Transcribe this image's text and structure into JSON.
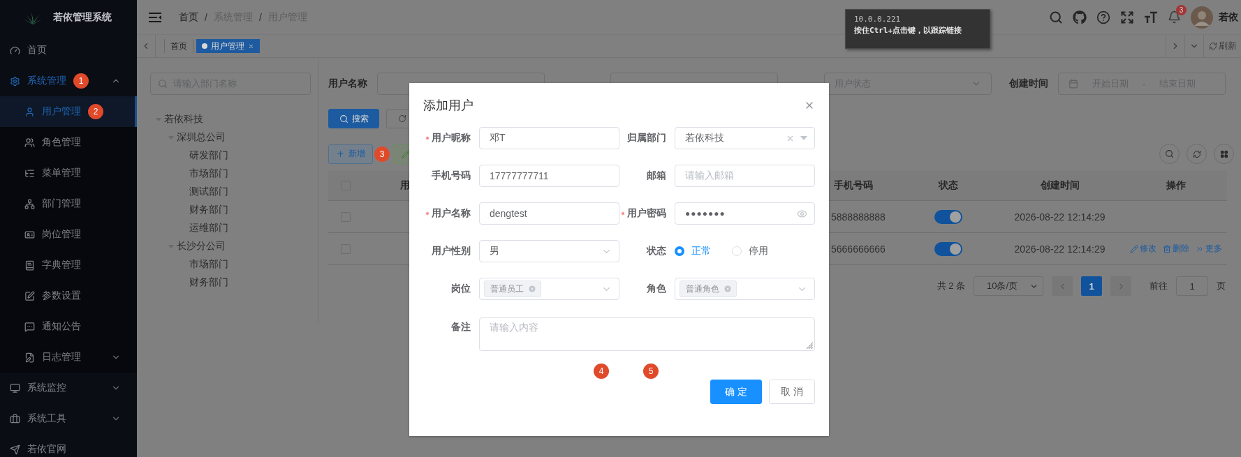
{
  "app": {
    "title": "若依管理系统"
  },
  "sidebar": {
    "items": [
      {
        "label": "首页",
        "selected": false
      },
      {
        "label": "系统管理",
        "selected": false,
        "expanded": true,
        "step": "1",
        "children": [
          {
            "label": "用户管理",
            "selected": true,
            "step": "2"
          },
          {
            "label": "角色管理",
            "selected": false
          },
          {
            "label": "菜单管理",
            "selected": false
          },
          {
            "label": "部门管理",
            "selected": false
          },
          {
            "label": "岗位管理",
            "selected": false
          },
          {
            "label": "字典管理",
            "selected": false
          },
          {
            "label": "参数设置",
            "selected": false
          },
          {
            "label": "通知公告",
            "selected": false
          },
          {
            "label": "日志管理",
            "selected": false,
            "expanded": false
          }
        ]
      },
      {
        "label": "系统监控",
        "selected": false,
        "expanded": false
      },
      {
        "label": "系统工具",
        "selected": false,
        "expanded": false
      },
      {
        "label": "若依官网",
        "selected": false
      }
    ]
  },
  "header": {
    "breadcrumb": [
      "首页",
      "系统管理",
      "用户管理"
    ],
    "separator": "/",
    "notifications": "3",
    "user": "若依"
  },
  "tooltip": {
    "lines": [
      "10.0.0.221",
      "按住Ctrl+点击键，以跟踪链接"
    ]
  },
  "tags": [
    {
      "label": "首页",
      "selected": false
    },
    {
      "label": "用户管理",
      "selected": true
    }
  ],
  "refresh": "刷新",
  "dept_panel": {
    "placeholder": "请输入部门名称",
    "tree": [
      {
        "label": "若依科技",
        "expanded": true,
        "children": [
          {
            "label": "深圳总公司",
            "expanded": true,
            "children": [
              {
                "label": "研发部门"
              },
              {
                "label": "市场部门"
              },
              {
                "label": "测试部门"
              },
              {
                "label": "财务部门"
              },
              {
                "label": "运维部门"
              }
            ]
          },
          {
            "label": "长沙分公司",
            "expanded": true,
            "children": [
              {
                "label": "市场部门"
              },
              {
                "label": "财务部门"
              }
            ]
          }
        ]
      }
    ]
  },
  "filters": [
    {
      "kind": "input",
      "label": "用户名称"
    },
    {
      "kind": "input"
    },
    {
      "kind": "select",
      "placeholder": "用户状态"
    },
    {
      "kind": "daterange",
      "label": "创建时间",
      "start": "开始日期",
      "separator": "-",
      "end": "结束日期"
    }
  ],
  "search_button": "搜索",
  "add_button": {
    "label": "新增",
    "step": "3"
  },
  "table": {
    "header_checked": false,
    "columns": [
      "用",
      "手机号码",
      "状态",
      "创建时间",
      "操作"
    ],
    "rows": [
      {
        "checked": false,
        "phone": "5888888888",
        "on": true,
        "created": "2026-08-22 12:14:29",
        "actions": []
      },
      {
        "checked": false,
        "phone": "5666666666",
        "on": true,
        "created": "2026-08-22 12:14:29",
        "actions": [
          "修改",
          "删除",
          "更多"
        ]
      }
    ]
  },
  "pagination": {
    "total": "共 2 条",
    "page_size": "10条/页",
    "pages": [
      {
        "label": "1",
        "selected": true
      }
    ],
    "goto": "前往",
    "goto_value": "1",
    "page_unit": "页"
  },
  "dialog": {
    "title": "添加用户",
    "fields": [
      {
        "kind": "input",
        "label": "用户昵称",
        "required": true,
        "value": "邓T"
      },
      {
        "kind": "tree-select",
        "label": "归属部门",
        "required": false,
        "value": "若依科技"
      },
      {
        "kind": "input",
        "label": "手机号码",
        "required": false,
        "value": "17777777711"
      },
      {
        "kind": "input",
        "label": "邮箱",
        "required": false,
        "placeholder": "请输入邮箱"
      },
      {
        "kind": "input",
        "label": "用户名称",
        "required": true,
        "value": "dengtest"
      },
      {
        "kind": "password",
        "label": "用户密码",
        "required": true,
        "value": "●●●●●●●"
      },
      {
        "kind": "select",
        "label": "用户性别",
        "required": false,
        "value": "男"
      },
      {
        "kind": "radio",
        "label": "状态",
        "required": false,
        "options": [
          {
            "label": "正常",
            "selected": true
          },
          {
            "label": "停用",
            "selected": false
          }
        ]
      },
      {
        "kind": "multi-select",
        "label": "岗位",
        "required": false,
        "tags": [
          "普通员工"
        ]
      },
      {
        "kind": "multi-select",
        "label": "角色",
        "required": false,
        "tags": [
          "普通角色"
        ]
      },
      {
        "kind": "textarea",
        "label": "备注",
        "required": false,
        "placeholder": "请输入内容"
      }
    ],
    "steps": [
      "4",
      "5"
    ],
    "buttons": [
      {
        "kind": "primary",
        "label": "确 定"
      },
      {
        "kind": "default",
        "label": "取 消"
      }
    ]
  }
}
